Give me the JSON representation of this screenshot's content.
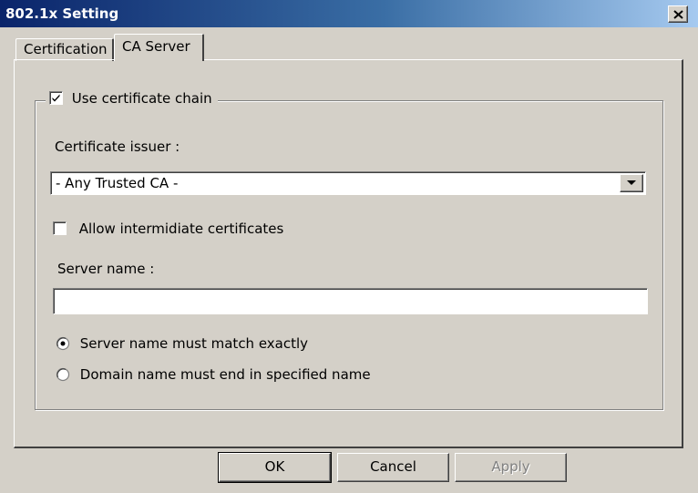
{
  "window": {
    "title": "802.1x Setting",
    "close_glyph": "close-icon"
  },
  "tabs": [
    {
      "label": "Certification",
      "selected": false
    },
    {
      "label": "CA Server",
      "selected": true
    }
  ],
  "group": {
    "label": "Use certificate chain",
    "checked": true
  },
  "issuer": {
    "label": "Certificate issuer :",
    "value": "- Any Trusted CA -"
  },
  "intermediate": {
    "label": "Allow intermidiate certificates",
    "checked": false
  },
  "server": {
    "label": "Server name :",
    "value": ""
  },
  "match_options": [
    {
      "label": "Server name must match exactly",
      "selected": true
    },
    {
      "label": "Domain name must end in specified name",
      "selected": false
    }
  ],
  "buttons": {
    "ok": "OK",
    "cancel": "Cancel",
    "apply": "Apply",
    "apply_enabled": false
  },
  "colors": {
    "face": "#d4d0c8",
    "title_start": "#0a246a",
    "title_end": "#a6caf0"
  }
}
